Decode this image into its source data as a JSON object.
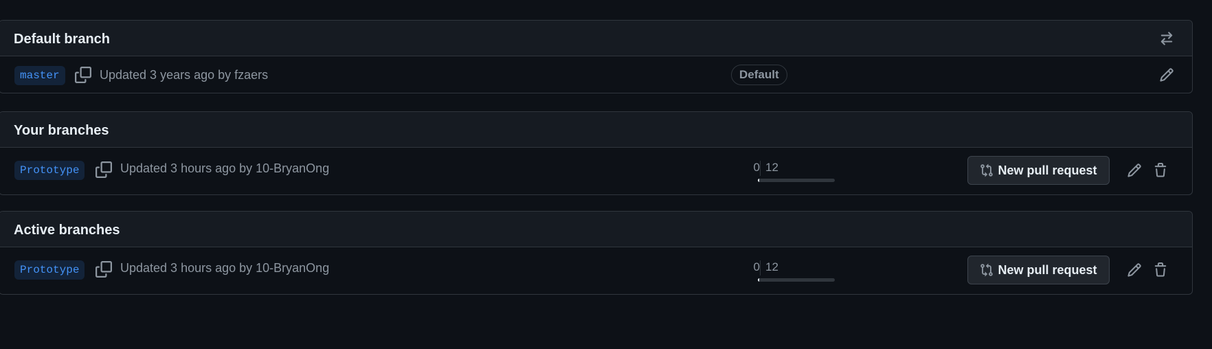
{
  "default_section": {
    "title": "Default branch",
    "switch_icon": "arrow-switch-icon",
    "row": {
      "branch": "master",
      "copy_icon": "copy-icon",
      "updated": "Updated 3 years ago by fzaers",
      "badge": "Default",
      "edit_icon": "pencil-icon"
    }
  },
  "your_section": {
    "title": "Your branches",
    "row": {
      "branch": "Prototype",
      "copy_icon": "copy-icon",
      "updated": "Updated 3 hours ago by 10-BryanOng",
      "behind": "0",
      "ahead": "12",
      "pr_button": "New pull request",
      "pr_icon": "git-compare-icon",
      "edit_icon": "pencil-icon",
      "delete_icon": "trash-icon"
    }
  },
  "active_section": {
    "title": "Active branches",
    "row": {
      "branch": "Prototype",
      "copy_icon": "copy-icon",
      "updated": "Updated 3 hours ago by 10-BryanOng",
      "behind": "0",
      "ahead": "12",
      "pr_button": "New pull request",
      "pr_icon": "git-compare-icon",
      "edit_icon": "pencil-icon",
      "delete_icon": "trash-icon"
    }
  },
  "colors": {
    "background": "#0d1117",
    "header_bg": "#161b22",
    "border": "#30363d",
    "branch_text": "#4493f8",
    "muted_text": "#8d96a0",
    "primary_text": "#e6edf3"
  }
}
